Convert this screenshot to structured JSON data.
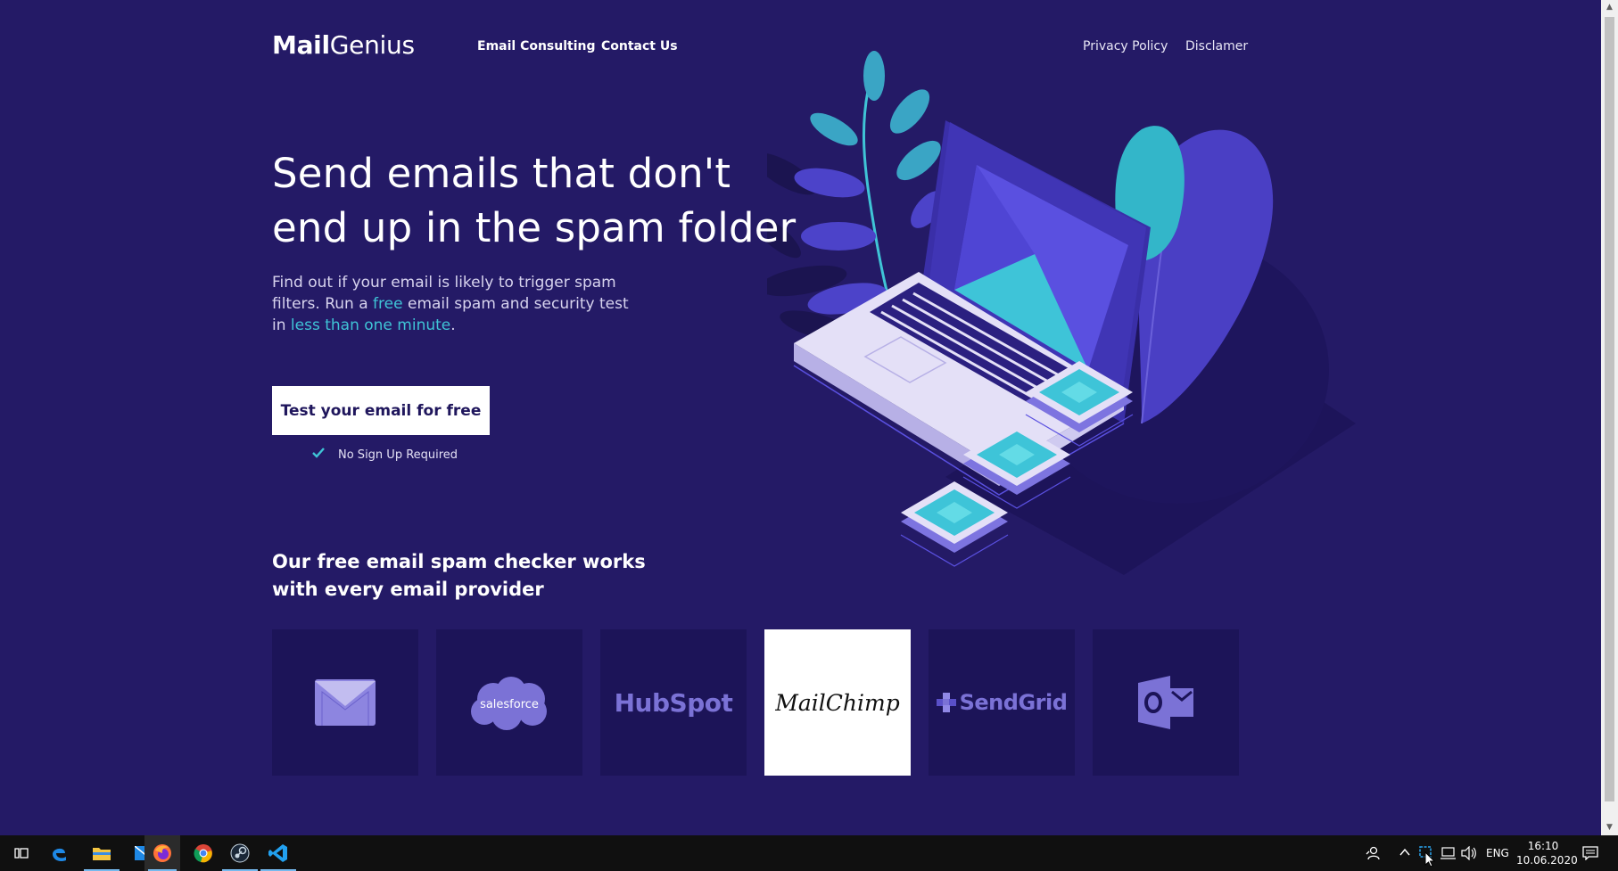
{
  "brand": {
    "logo_bold": "Mail",
    "logo_light": "Genius"
  },
  "nav": {
    "left": [
      "Email Consulting",
      "Contact Us"
    ],
    "right": [
      "Privacy Policy",
      "Disclamer"
    ]
  },
  "hero": {
    "title_line1": "Send emails that don't",
    "title_line2": "end up in the spam folder",
    "text_part1": "Find out if your email is likely to trigger spam filters. Run a ",
    "text_free": "free",
    "text_part2": " email spam and security test in ",
    "text_time": "less than one minute",
    "text_end": ".",
    "cta_label": "Test your email for free",
    "no_signup": "No Sign Up Required"
  },
  "providers": {
    "title_line1": "Our free email spam checker works",
    "title_line2": "with every email provider",
    "items": [
      {
        "name": "Gmail",
        "icon": "gmail-envelope-icon",
        "label": ""
      },
      {
        "name": "Salesforce",
        "icon": "salesforce-cloud-logo",
        "label": "salesforce"
      },
      {
        "name": "HubSpot",
        "icon": "hubspot-logo",
        "label": "HubSpot"
      },
      {
        "name": "MailChimp",
        "icon": "mailchimp-logo",
        "label": "MailChimp",
        "highlighted": true
      },
      {
        "name": "SendGrid",
        "icon": "sendgrid-logo",
        "label": "SendGrid"
      },
      {
        "name": "Outlook",
        "icon": "outlook-logo",
        "label": ""
      }
    ]
  },
  "colors": {
    "background": "#241a66",
    "tile": "#1c1458",
    "accent": "#3fc4d6",
    "provider_logo": "#7b72d6"
  },
  "taskbar": {
    "apps": [
      "task-view-icon",
      "edge-icon",
      "file-explorer-icon",
      "mail-icon",
      "firefox-icon",
      "chrome-icon",
      "steam-icon",
      "vscode-icon"
    ],
    "tray": {
      "language": "ENG",
      "time": "16:10",
      "date": "10.06.2020"
    }
  }
}
